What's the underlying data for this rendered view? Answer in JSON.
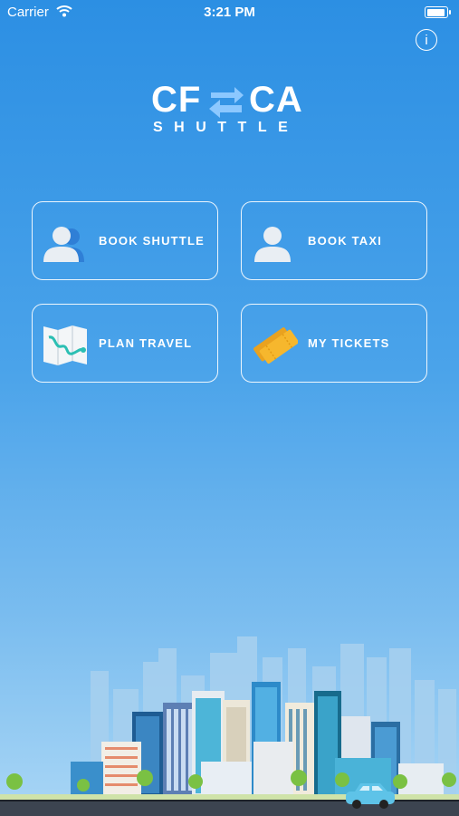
{
  "status_bar": {
    "carrier": "Carrier",
    "time": "3:21 PM"
  },
  "info_button": {
    "glyph": "i"
  },
  "logo": {
    "text_left": "CF",
    "text_right": "CA",
    "subtitle": "SHUTTLE",
    "arrow_color": "#8cc8ff"
  },
  "tiles": [
    {
      "label": "BOOK SHUTTLE",
      "icon": "people-icon"
    },
    {
      "label": "BOOK TAXI",
      "icon": "person-icon"
    },
    {
      "label": "PLAN TRAVEL",
      "icon": "map-icon"
    },
    {
      "label": "MY TICKETS",
      "icon": "tickets-icon"
    }
  ],
  "colors": {
    "background_top": "#2c8fe3",
    "background_bottom": "#a9d6f5",
    "ticket": "#f6b72d"
  }
}
